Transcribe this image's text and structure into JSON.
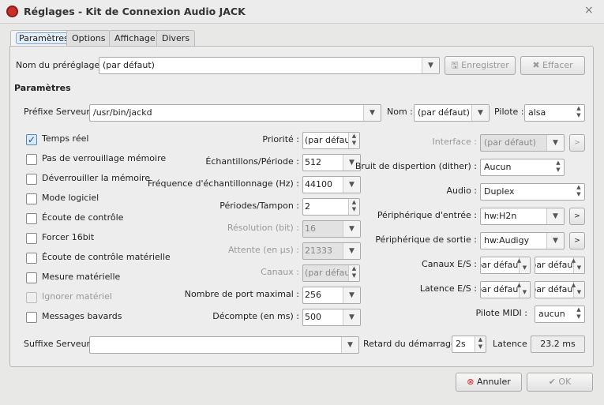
{
  "window": {
    "title": "Réglages - Kit de Connexion Audio JACK",
    "close": "×"
  },
  "tabs": [
    "Paramètres",
    "Options",
    "Affichage",
    "Divers"
  ],
  "preset": {
    "label": "Nom du préréglage :",
    "value": "(par défaut)",
    "save": "Enregistrer",
    "delete": "Effacer"
  },
  "section": "Paramètres",
  "server_prefix": {
    "label": "Préfixe Serveur :",
    "value": "/usr/bin/jackd"
  },
  "name": {
    "label": "Nom :",
    "value": "(par défaut)"
  },
  "driver": {
    "label": "Pilote :",
    "value": "alsa"
  },
  "checkboxes": [
    {
      "label": "Temps réel",
      "checked": true,
      "enabled": true
    },
    {
      "label": "Pas de verrouillage mémoire",
      "checked": false,
      "enabled": true
    },
    {
      "label": "Déverrouiller la mémoire",
      "checked": false,
      "enabled": true
    },
    {
      "label": "Mode logiciel",
      "checked": false,
      "enabled": true
    },
    {
      "label": "Écoute de contrôle",
      "checked": false,
      "enabled": true
    },
    {
      "label": "Forcer 16bit",
      "checked": false,
      "enabled": true
    },
    {
      "label": "Écoute de contrôle matérielle",
      "checked": false,
      "enabled": true
    },
    {
      "label": "Mesure matérielle",
      "checked": false,
      "enabled": true
    },
    {
      "label": "Ignorer matériel",
      "checked": false,
      "enabled": false
    },
    {
      "label": "Messages bavards",
      "checked": false,
      "enabled": true
    }
  ],
  "middle": [
    {
      "label": "Priorité :",
      "value": "(par défaut)",
      "kind": "spin",
      "enabled": true
    },
    {
      "label": "Échantillons/Période :",
      "value": "512",
      "kind": "combo",
      "enabled": true
    },
    {
      "label": "Fréquence d'échantillonnage (Hz) :",
      "value": "44100",
      "kind": "combo",
      "enabled": true
    },
    {
      "label": "Périodes/Tampon :",
      "value": "2",
      "kind": "spin",
      "enabled": true
    },
    {
      "label": "Résolution (bit) :",
      "value": "16",
      "kind": "combo",
      "enabled": false
    },
    {
      "label": "Attente (en µs) :",
      "value": "21333",
      "kind": "combo",
      "enabled": false
    },
    {
      "label": "Canaux :",
      "value": "(par défaut)",
      "kind": "spin",
      "enabled": false
    },
    {
      "label": "Nombre de port maximal :",
      "value": "256",
      "kind": "combo",
      "enabled": true
    },
    {
      "label": "Décompte (en ms) :",
      "value": "500",
      "kind": "combo",
      "enabled": true
    }
  ],
  "right": {
    "interface": {
      "label": "Interface :",
      "value": "(par défaut)",
      "more": ">"
    },
    "dither": {
      "label": "Bruit de dispertion (dither) :",
      "value": "Aucun"
    },
    "audio": {
      "label": "Audio :",
      "value": "Duplex"
    },
    "input_device": {
      "label": "Périphérique d'entrée :",
      "value": "hw:H2n",
      "more": ">"
    },
    "output_device": {
      "label": "Périphérique de sortie :",
      "value": "hw:Audigy",
      "more": ">"
    },
    "channels_io": {
      "label": "Canaux E/S :",
      "in": "(par défaut)",
      "out": "(par défaut)"
    },
    "latency_io": {
      "label": "Latence E/S :",
      "in": "(par défaut)",
      "out": "(par défaut)"
    },
    "midi_driver": {
      "label": "Pilote MIDI :",
      "value": "aucun"
    }
  },
  "server_suffix": {
    "label": "Suffixe Serveur :",
    "value": ""
  },
  "start_delay": {
    "label": "Retard du démarrage :",
    "value": "2s"
  },
  "latency": {
    "label": "Latence :",
    "value": "23.2 ms"
  },
  "buttons": {
    "cancel": "Annuler",
    "ok": "OK"
  }
}
